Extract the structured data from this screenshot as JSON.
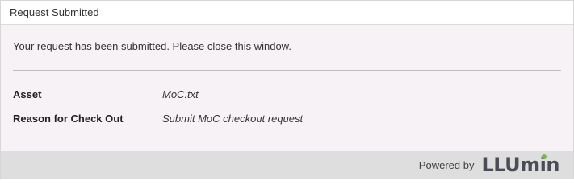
{
  "dialog": {
    "title": "Request Submitted",
    "message": "Your request has been submitted. Please close this window.",
    "details": [
      {
        "label": "Asset",
        "value": "MoC.txt"
      },
      {
        "label": "Reason for Check Out",
        "value": "Submit MoC checkout request"
      }
    ]
  },
  "footer": {
    "powered_by": "Powered by",
    "logo_text": "LLUmin",
    "logo_colors": {
      "text": "#4a4d56",
      "dot": "#7ab648"
    }
  }
}
